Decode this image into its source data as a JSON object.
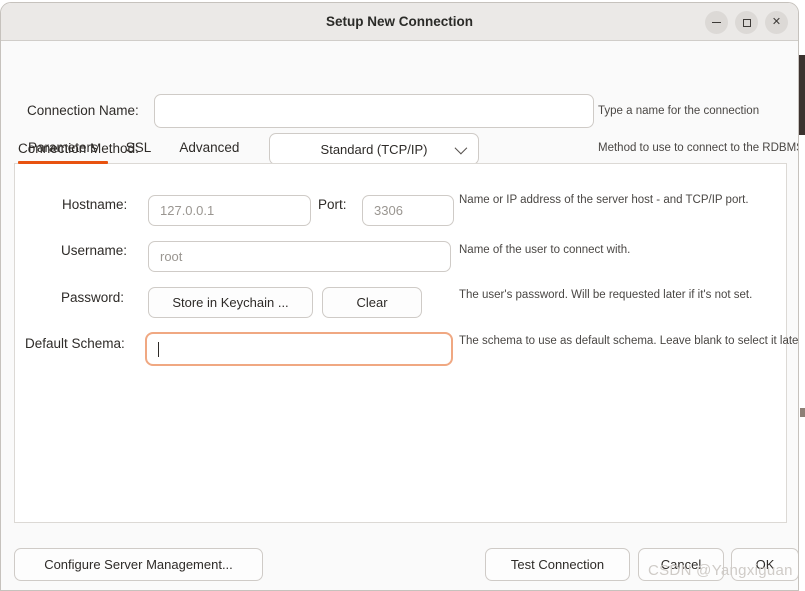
{
  "window": {
    "title": "Setup New Connection",
    "controls": [
      {
        "name": "minimize",
        "glyph": ""
      },
      {
        "name": "maximize",
        "glyph": ""
      },
      {
        "name": "close",
        "glyph": "✕"
      }
    ]
  },
  "topform": {
    "connection_name": {
      "label": "Connection Name:",
      "value": "",
      "placeholder": "",
      "hint": "Type a name for the connection"
    },
    "connection_method": {
      "label": "Connection Method:",
      "selected": "Standard (TCP/IP)",
      "options": [
        "Standard (TCP/IP)"
      ],
      "hint": "Method to use to connect to the RDBMS"
    }
  },
  "tabs": [
    {
      "label": "Parameters",
      "active": true
    },
    {
      "label": "SSL",
      "active": false
    },
    {
      "label": "Advanced",
      "active": false
    }
  ],
  "parameters": {
    "hostname": {
      "label": "Hostname:",
      "value": "",
      "placeholder": "127.0.0.1"
    },
    "port": {
      "label": "Port:",
      "value": "",
      "placeholder": "3306"
    },
    "hostname_port_hint": "Name or IP address of the server host - and TCP/IP port.",
    "username": {
      "label": "Username:",
      "value": "",
      "placeholder": "root",
      "hint": "Name of the user to connect with."
    },
    "password": {
      "label": "Password:",
      "store_button": "Store in Keychain ...",
      "clear_button": "Clear",
      "hint": "The user's password. Will be requested later if it's not set."
    },
    "default_schema": {
      "label": "Default Schema:",
      "value": "",
      "placeholder": "",
      "hint": "The schema to use as default schema. Leave blank to select it later.",
      "focused": true
    }
  },
  "footer": {
    "configure_server_management": "Configure Server Management...",
    "test_connection": "Test Connection",
    "cancel": "Cancel",
    "ok": "OK"
  },
  "watermark": "CSDN @Yangxiguan",
  "colors": {
    "accent": "#e8520f",
    "focus_border": "#f0a882",
    "titlebar": "#ebe9e7",
    "panel": "#ffffff",
    "window_bg": "#fafafa"
  }
}
